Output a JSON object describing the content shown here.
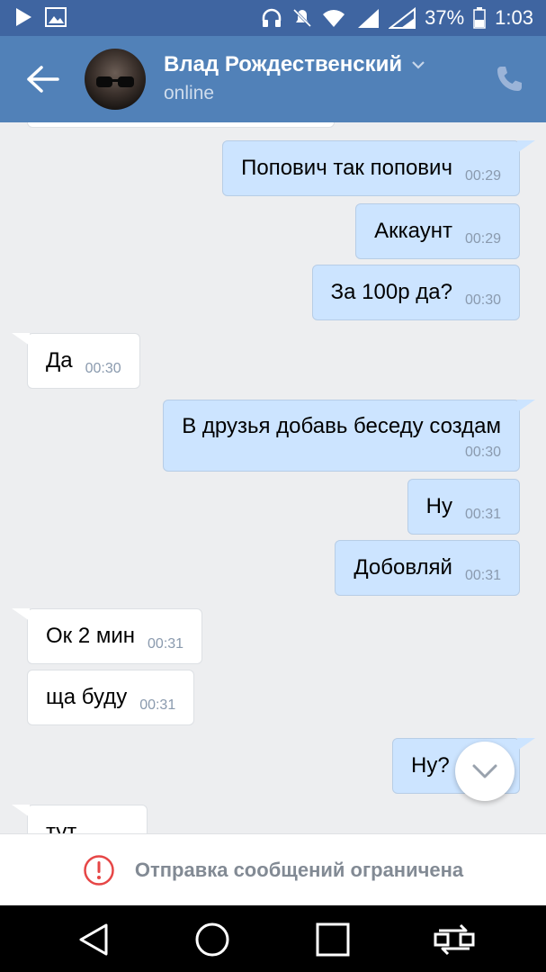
{
  "status_bar": {
    "battery": "37%",
    "time": "1:03"
  },
  "header": {
    "name": "Влад Рождественский",
    "status": "online"
  },
  "messages": [
    {
      "dir": "out",
      "text": "Попович так попович",
      "time": "00:29"
    },
    {
      "dir": "out",
      "text": "Аккаунт",
      "time": "00:29"
    },
    {
      "dir": "out",
      "text": "За 100р да?",
      "time": "00:30"
    },
    {
      "dir": "in",
      "text": "Да",
      "time": "00:30"
    },
    {
      "dir": "out",
      "text": "В друзья добавь беседу создам",
      "time": "00:30"
    },
    {
      "dir": "out",
      "text": "Ну",
      "time": "00:31"
    },
    {
      "dir": "out",
      "text": "Добовляй",
      "time": "00:31"
    },
    {
      "dir": "in",
      "text": "Ок 2 мин",
      "time": "00:31"
    },
    {
      "dir": "in",
      "text": "ща буду",
      "time": "00:31"
    },
    {
      "dir": "out",
      "text": "Ну?",
      "time": ""
    },
    {
      "dir": "in",
      "text": "тут",
      "time": ""
    }
  ],
  "restriction": {
    "text": "Отправка сообщений ограничена"
  },
  "colors": {
    "status_bar": "#3f65a1",
    "header": "#5181b8",
    "outgoing_bubble": "#cce4ff",
    "incoming_bubble": "#ffffff",
    "background": "#edeef0",
    "warning": "#e64646"
  }
}
